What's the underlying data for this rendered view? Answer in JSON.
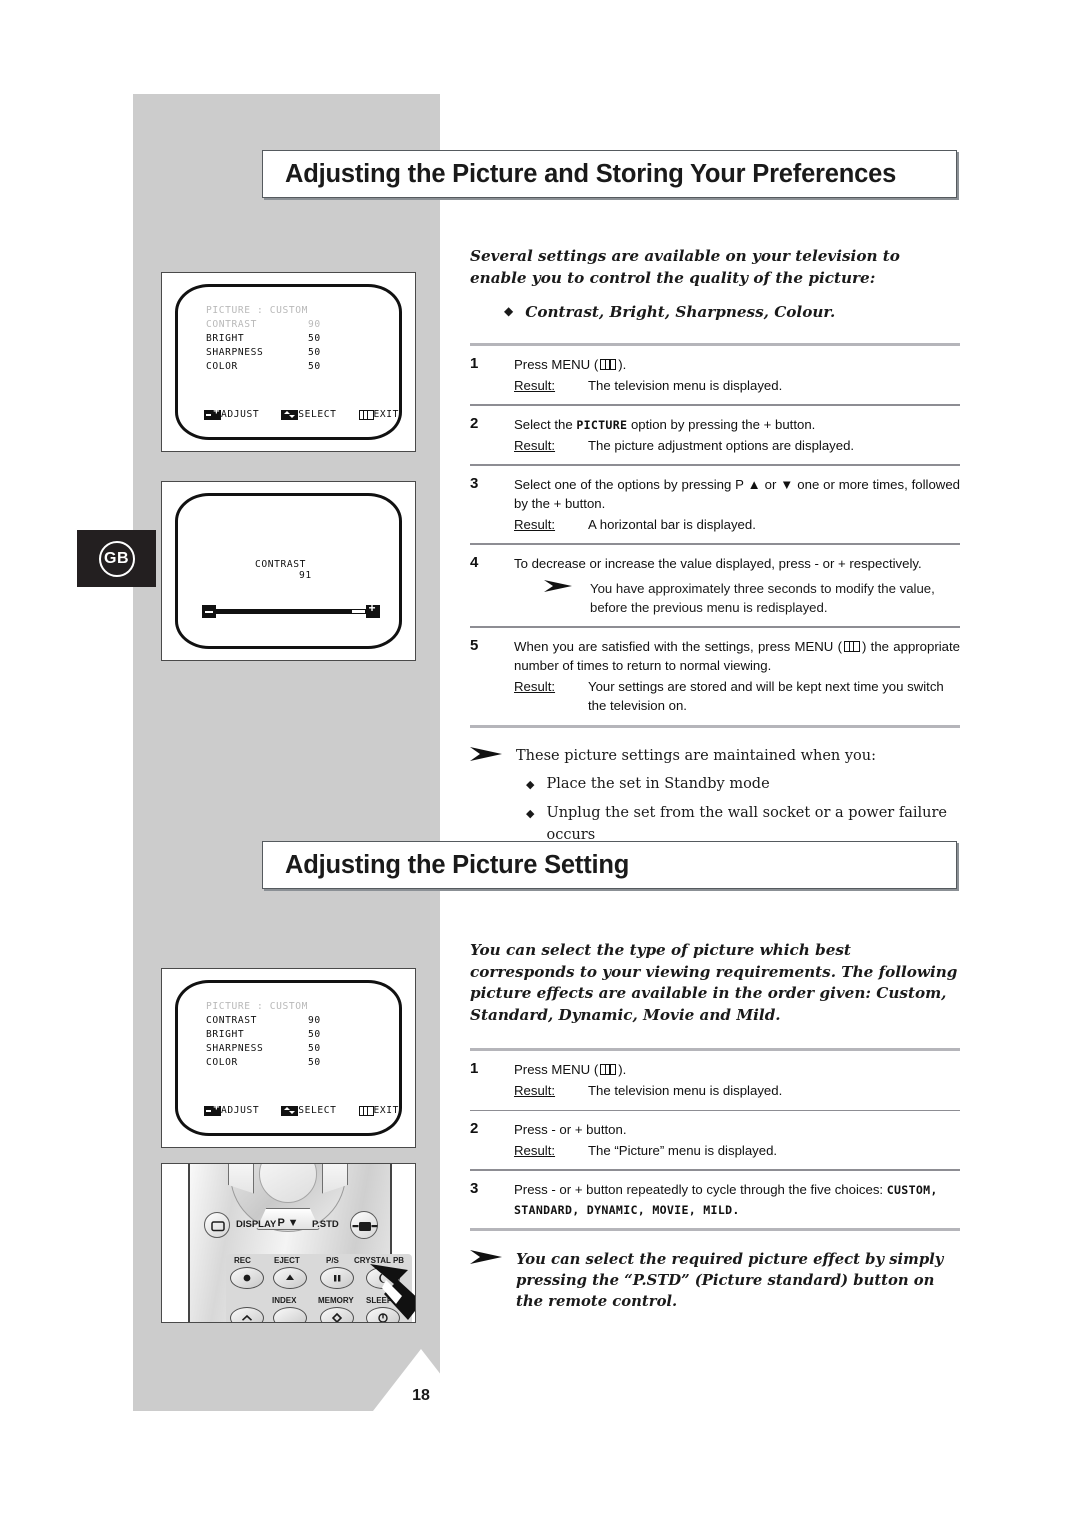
{
  "page": {
    "number": "18",
    "locale_tab": "GB"
  },
  "sections": [
    {
      "title": "Adjusting the Picture and Storing Your Preferences",
      "intro": "Several settings are available on your television to enable you to control the quality of the picture:",
      "intro_bullet": "Contrast, Bright, Sharpness, Colour.",
      "steps": [
        {
          "number": "1",
          "text_before": "Press MENU (",
          "text_after": ").",
          "result_label": "Result:",
          "result": "The television menu is displayed."
        },
        {
          "number": "2",
          "text_before": "Select the ",
          "emphasis": "PICTURE",
          "text_after": " option by pressing the + button.",
          "result_label": "Result:",
          "result": "The picture adjustment options are displayed."
        },
        {
          "number": "3",
          "text": "Select one of the options by pressing P ▲ or ▼ one or more times, followed by the + button.",
          "result_label": "Result:",
          "result": "A horizontal bar is displayed."
        },
        {
          "number": "4",
          "text": "To decrease or increase the value displayed, press - or + respectively.",
          "sub_note": "You have approximately three seconds to modify the value, before the previous menu is redisplayed."
        },
        {
          "number": "5",
          "text_before": "When you are satisfied with the settings, press MENU (",
          "text_after": ") the appropriate number of times to return to normal viewing.",
          "result_label": "Result:",
          "result": "Your settings are stored and will be kept next time you switch the television on."
        }
      ],
      "closing_note": {
        "lead": "These picture settings are maintained when you:",
        "bullets": [
          "Place the set in Standby mode",
          "Unplug the set from the wall socket or a power failure occurs"
        ]
      }
    },
    {
      "title": "Adjusting the Picture Setting",
      "intro": "You can select the type of picture which best corresponds to your viewing requirements. The following picture effects are available in the order given: Custom, Standard, Dynamic, Movie and Mild.",
      "steps": [
        {
          "number": "1",
          "text_before": "Press MENU (",
          "text_after": ").",
          "result_label": "Result:",
          "result": "The television menu is displayed."
        },
        {
          "number": "2",
          "text": "Press - or + button.",
          "result_label": "Result:",
          "result": "The “Picture” menu is displayed."
        },
        {
          "number": "3",
          "text_before": "Press - or + button repeatedly to cycle through the five choices: ",
          "emphasis": "CUSTOM,",
          "emphasis2": "STANDARD, DYNAMIC, MOVIE, MILD."
        }
      ],
      "closing_note": {
        "text": "You can select the required picture effect by simply pressing the “P.STD” (Picture standard) button on the remote control."
      }
    }
  ],
  "illustrations": {
    "tv_menu_1": {
      "header": "PICTURE : CUSTOM",
      "rows": [
        {
          "label": "CONTRAST",
          "value": "90",
          "dim": true
        },
        {
          "label": "BRIGHT",
          "value": "50",
          "dim": false
        },
        {
          "label": "SHARPNESS",
          "value": "50",
          "dim": false
        },
        {
          "label": "COLOR",
          "value": "50",
          "dim": false
        }
      ],
      "footer": {
        "adjust": "ADJUST",
        "select": "SELECT",
        "exit": "EXIT"
      }
    },
    "tv_bar": {
      "label": "CONTRAST",
      "value": "91",
      "fill_percent": 91
    },
    "tv_menu_2": {
      "header": "PICTURE : CUSTOM",
      "header_dim": true,
      "rows": [
        {
          "label": "CONTRAST",
          "value": "90",
          "dim": false
        },
        {
          "label": "BRIGHT",
          "value": "50",
          "dim": false
        },
        {
          "label": "SHARPNESS",
          "value": "50",
          "dim": false
        },
        {
          "label": "COLOR",
          "value": "50",
          "dim": false
        }
      ],
      "footer": {
        "adjust": "ADJUST",
        "select": "SELECT",
        "exit": "EXIT"
      }
    },
    "remote": {
      "p_down": "P ▼",
      "display": "DISPLAY",
      "pstd": "P.STD",
      "keys_top": [
        "REC",
        "EJECT",
        "P/S",
        "CRYSTAL PB"
      ],
      "keys_bottom": [
        "INDEX",
        "MEMORY",
        "SLEEP"
      ]
    }
  },
  "colors": {
    "band": "#cccccc",
    "tab": "#231f20",
    "rule": "#b5b5ba",
    "text": "#1a1a1a"
  }
}
